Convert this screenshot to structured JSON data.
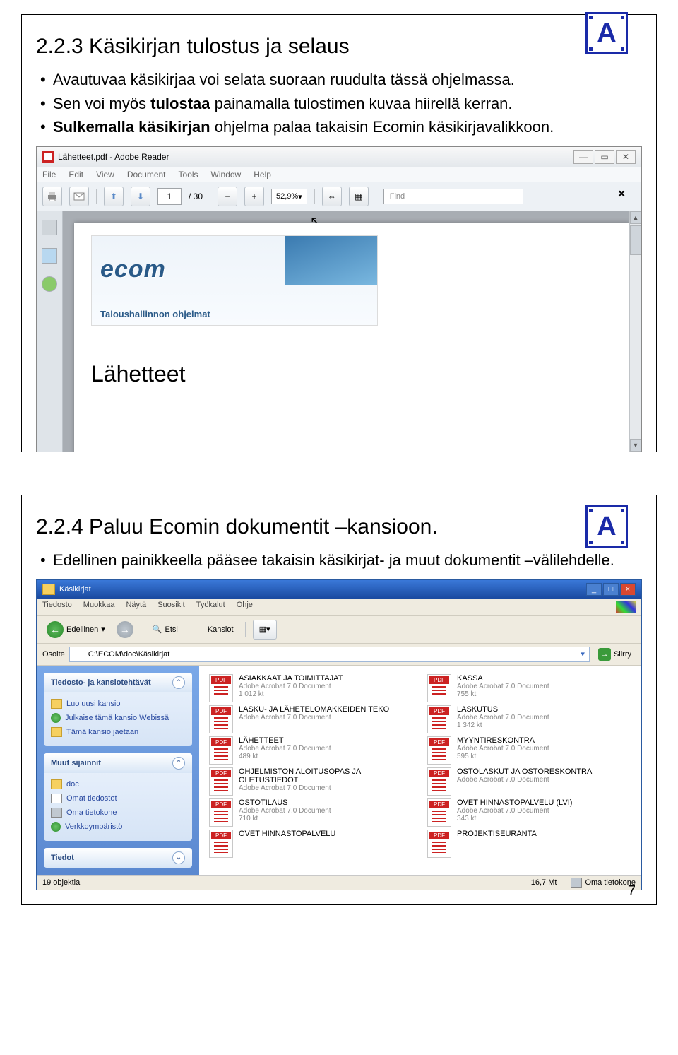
{
  "page_number": "7",
  "section1": {
    "title": "2.2.3 Käsikirjan tulostus ja selaus",
    "bullet1": "Avautuvaa käsikirjaa voi selata suoraan ruudulta tässä ohjelmassa.",
    "bullet2a": "Sen voi myös ",
    "bullet2b": "tulostaa",
    "bullet2c": " painamalla tulostimen kuvaa hiirellä kerran.",
    "bullet3a": "Sulkemalla käsikirjan",
    "bullet3b": " ohjelma palaa takaisin Ecomin käsikirjavalikkoon.",
    "a_block": "A"
  },
  "reader": {
    "title": "Lähetteet.pdf - Adobe Reader",
    "menu": [
      "File",
      "Edit",
      "View",
      "Document",
      "Tools",
      "Window",
      "Help"
    ],
    "page_current": "1",
    "page_total": "/ 30",
    "zoom": "52,9%",
    "find_placeholder": "Find",
    "banner_logo": "ecom",
    "banner_sub": "Taloushallinnon ohjelmat",
    "doc_heading": "Lähetteet"
  },
  "section2": {
    "title": "2.2.4 Paluu Ecomin dokumentit –kansioon.",
    "bullet1": "Edellinen painikkeella pääsee takaisin käsikirjat- ja muut dokumentit –välilehdelle.",
    "a_block": "A"
  },
  "explorer": {
    "title": "Käsikirjat",
    "menu": [
      "Tiedosto",
      "Muokkaa",
      "Näytä",
      "Suosikit",
      "Työkalut",
      "Ohje"
    ],
    "back_label": "Edellinen",
    "search_label": "Etsi",
    "folders_label": "Kansiot",
    "addr_label": "Osoite",
    "addr_value": "C:\\ECOM\\doc\\Käsikirjat",
    "go_label": "Siirry",
    "panels": {
      "tasks_hdr": "Tiedosto- ja kansiotehtävät",
      "tasks": [
        "Luo uusi kansio",
        "Julkaise tämä kansio Webissä",
        "Tämä kansio jaetaan"
      ],
      "places_hdr": "Muut sijainnit",
      "places": [
        "doc",
        "Omat tiedostot",
        "Oma tietokone",
        "Verkkoympäristö"
      ],
      "details_hdr": "Tiedot"
    },
    "files": [
      {
        "name": "ASIAKKAAT JA TOIMITTAJAT",
        "type": "Adobe Acrobat 7.0 Document",
        "size": "1 012 kt"
      },
      {
        "name": "KASSA",
        "type": "Adobe Acrobat 7.0 Document",
        "size": "755 kt"
      },
      {
        "name": "LASKU- JA LÄHETELOMAKKEIDEN TEKO",
        "type": "Adobe Acrobat 7.0 Document",
        "size": ""
      },
      {
        "name": "LASKUTUS",
        "type": "Adobe Acrobat 7.0 Document",
        "size": "1 342 kt"
      },
      {
        "name": "LÄHETTEET",
        "type": "Adobe Acrobat 7.0 Document",
        "size": "489 kt"
      },
      {
        "name": "MYYNTIRESKONTRA",
        "type": "Adobe Acrobat 7.0 Document",
        "size": "595 kt"
      },
      {
        "name": "OHJELMISTON ALOITUSOPAS JA OLETUSTIEDOT",
        "type": "Adobe Acrobat 7.0 Document",
        "size": ""
      },
      {
        "name": "OSTOLASKUT JA OSTORESKONTRA",
        "type": "Adobe Acrobat 7.0 Document",
        "size": ""
      },
      {
        "name": "OSTOTILAUS",
        "type": "Adobe Acrobat 7.0 Document",
        "size": "710 kt"
      },
      {
        "name": "OVET HINNASTOPALVELU (LVI)",
        "type": "Adobe Acrobat 7.0 Document",
        "size": "343 kt"
      },
      {
        "name": "OVET HINNASTOPALVELU",
        "type": "",
        "size": ""
      },
      {
        "name": "PROJEKTISEURANTA",
        "type": "",
        "size": ""
      }
    ],
    "status_left": "19 objektia",
    "status_size": "16,7 Mt",
    "status_loc": "Oma tietokone"
  }
}
